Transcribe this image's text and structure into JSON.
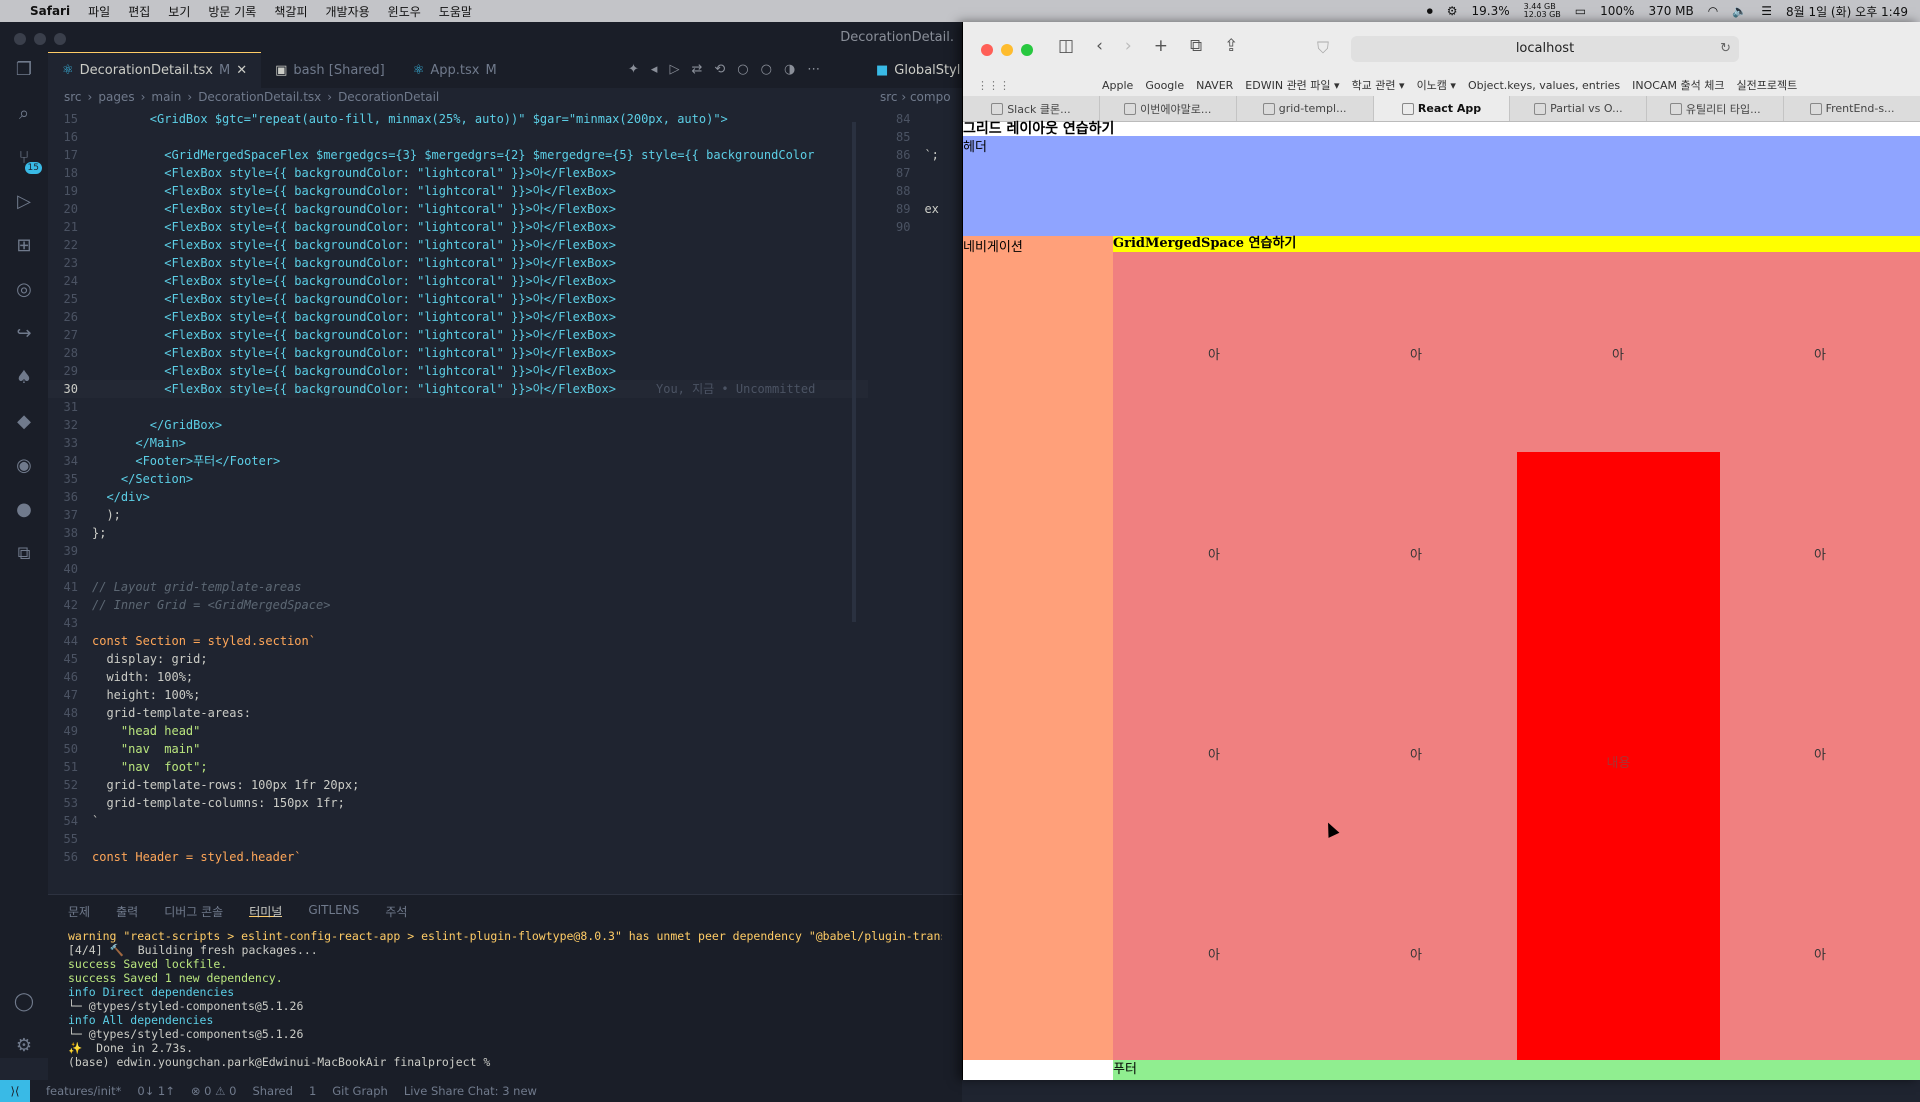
{
  "menubar": {
    "app": "Safari",
    "items": [
      "파일",
      "편집",
      "보기",
      "방문 기록",
      "책갈피",
      "개발자용",
      "윈도우",
      "도움말"
    ],
    "cpu": "19.3%",
    "mem_top": "3.44 GB",
    "mem_bottom": "12.03 GB",
    "battery": "100%",
    "ram": "370 MB",
    "datetime": "8월 1일 (화) 오후 1:49"
  },
  "vscode": {
    "window_title": "DecorationDetail.",
    "tabs": [
      {
        "label": "DecorationDetail.tsx",
        "mod": "M"
      },
      {
        "label": "bash [Shared]",
        "mod": ""
      },
      {
        "label": "App.tsx",
        "mod": "M"
      }
    ],
    "right_tab": "GlobalStyl",
    "breadcrumb": [
      "src",
      "pages",
      "main",
      "DecorationDetail.tsx",
      "DecorationDetail"
    ],
    "right_breadcrumb": "src › compo",
    "code_lines": [
      {
        "n": "15",
        "text": "        <GridBox $gtc=\"repeat(auto-fill, minmax(25%, auto))\" $gar=\"minmax(200px, auto)\">",
        "cls": "tag"
      },
      {
        "n": "16",
        "text": "",
        "cls": ""
      },
      {
        "n": "17",
        "text": "          <GridMergedSpaceFlex $mergedgcs={3} $mergedgrs={2} $mergedgre={5} style={{ backgroundColor",
        "cls": "tag"
      },
      {
        "n": "18",
        "text": "          <FlexBox style={{ backgroundColor: \"lightcoral\" }}>아</FlexBox>",
        "cls": "tag"
      },
      {
        "n": "19",
        "text": "          <FlexBox style={{ backgroundColor: \"lightcoral\" }}>아</FlexBox>",
        "cls": "tag"
      },
      {
        "n": "20",
        "text": "          <FlexBox style={{ backgroundColor: \"lightcoral\" }}>아</FlexBox>",
        "cls": "tag"
      },
      {
        "n": "21",
        "text": "          <FlexBox style={{ backgroundColor: \"lightcoral\" }}>아</FlexBox>",
        "cls": "tag"
      },
      {
        "n": "22",
        "text": "          <FlexBox style={{ backgroundColor: \"lightcoral\" }}>아</FlexBox>",
        "cls": "tag"
      },
      {
        "n": "23",
        "text": "          <FlexBox style={{ backgroundColor: \"lightcoral\" }}>아</FlexBox>",
        "cls": "tag"
      },
      {
        "n": "24",
        "text": "          <FlexBox style={{ backgroundColor: \"lightcoral\" }}>아</FlexBox>",
        "cls": "tag"
      },
      {
        "n": "25",
        "text": "          <FlexBox style={{ backgroundColor: \"lightcoral\" }}>아</FlexBox>",
        "cls": "tag"
      },
      {
        "n": "26",
        "text": "          <FlexBox style={{ backgroundColor: \"lightcoral\" }}>아</FlexBox>",
        "cls": "tag"
      },
      {
        "n": "27",
        "text": "          <FlexBox style={{ backgroundColor: \"lightcoral\" }}>아</FlexBox>",
        "cls": "tag"
      },
      {
        "n": "28",
        "text": "          <FlexBox style={{ backgroundColor: \"lightcoral\" }}>아</FlexBox>",
        "cls": "tag"
      },
      {
        "n": "29",
        "text": "          <FlexBox style={{ backgroundColor: \"lightcoral\" }}>아</FlexBox>",
        "cls": "tag"
      },
      {
        "n": "30",
        "text": "          <FlexBox style={{ backgroundColor: \"lightcoral\" }}>아</FlexBox>",
        "cls": "tag",
        "ghost": "You, 지금 • Uncommitted"
      },
      {
        "n": "31",
        "text": "",
        "cls": ""
      },
      {
        "n": "32",
        "text": "        </GridBox>",
        "cls": "tag"
      },
      {
        "n": "33",
        "text": "      </Main>",
        "cls": "tag"
      },
      {
        "n": "34",
        "text": "      <Footer>푸터</Footer>",
        "cls": "tag"
      },
      {
        "n": "35",
        "text": "    </Section>",
        "cls": "tag"
      },
      {
        "n": "36",
        "text": "  </div>",
        "cls": "tag"
      },
      {
        "n": "37",
        "text": "  );",
        "cls": ""
      },
      {
        "n": "38",
        "text": "};",
        "cls": ""
      },
      {
        "n": "39",
        "text": "",
        "cls": ""
      },
      {
        "n": "40",
        "text": "",
        "cls": ""
      },
      {
        "n": "41",
        "text": "// Layout grid-template-areas",
        "cls": "comment"
      },
      {
        "n": "42",
        "text": "// Inner Grid = <GridMergedSpace>",
        "cls": "comment"
      },
      {
        "n": "43",
        "text": "",
        "cls": ""
      },
      {
        "n": "44",
        "text": "const Section = styled.section`",
        "cls": "kw"
      },
      {
        "n": "45",
        "text": "  display: grid;",
        "cls": ""
      },
      {
        "n": "46",
        "text": "  width: 100%;",
        "cls": ""
      },
      {
        "n": "47",
        "text": "  height: 100%;",
        "cls": ""
      },
      {
        "n": "48",
        "text": "  grid-template-areas:",
        "cls": ""
      },
      {
        "n": "49",
        "text": "    \"head head\"",
        "cls": "str"
      },
      {
        "n": "50",
        "text": "    \"nav  main\"",
        "cls": "str"
      },
      {
        "n": "51",
        "text": "    \"nav  foot\";",
        "cls": "str"
      },
      {
        "n": "52",
        "text": "  grid-template-rows: 100px 1fr 20px;",
        "cls": ""
      },
      {
        "n": "53",
        "text": "  grid-template-columns: 150px 1fr;",
        "cls": ""
      },
      {
        "n": "54",
        "text": "`",
        "cls": ""
      },
      {
        "n": "55",
        "text": "",
        "cls": ""
      },
      {
        "n": "56",
        "text": "const Header = styled.header`",
        "cls": "kw"
      }
    ],
    "right_code": [
      {
        "n": "84",
        "text": ""
      },
      {
        "n": "85",
        "text": ""
      },
      {
        "n": "86",
        "text": "`;"
      },
      {
        "n": "87",
        "text": ""
      },
      {
        "n": "88",
        "text": ""
      },
      {
        "n": "89",
        "text": "ex"
      },
      {
        "n": "90",
        "text": ""
      }
    ],
    "panel_tabs": [
      "문제",
      "출력",
      "디버그 콘솔",
      "터미널",
      "GITLENS",
      "주석"
    ],
    "terminal": [
      {
        "cls": "t-warn",
        "text": "warning \"react-scripts > eslint-config-react-app > eslint-plugin-flowtype@8.0.3\" has unmet peer dependency \"@babel/plugin-trans"
      },
      {
        "cls": "",
        "text": "[4/4] 🔨  Building fresh packages..."
      },
      {
        "cls": "t-succ",
        "text": "success Saved lockfile."
      },
      {
        "cls": "t-succ",
        "text": "success Saved 1 new dependency."
      },
      {
        "cls": "t-info",
        "text": "info Direct dependencies"
      },
      {
        "cls": "",
        "text": "└─ @types/styled-components@5.1.26"
      },
      {
        "cls": "t-info",
        "text": "info All dependencies"
      },
      {
        "cls": "",
        "text": "└─ @types/styled-components@5.1.26"
      },
      {
        "cls": "",
        "text": "✨  Done in 2.73s."
      },
      {
        "cls": "",
        "text": "(base) edwin.youngchan.park@Edwinui-MacBookAir finalproject % "
      }
    ],
    "status": {
      "branch": "features/init*",
      "sync": "0↓ 1↑",
      "problems": "⊗ 0 ⚠ 0",
      "shared": "Shared",
      "count": "1",
      "git_graph": "Git Graph",
      "live_share": "Live Share Chat: 3 new"
    }
  },
  "safari": {
    "url": "localhost",
    "favorites": [
      "Apple",
      "Google",
      "NAVER",
      "EDWIN 관련 파일 ▾",
      "학교 관련 ▾",
      "이노캠 ▾",
      "Object.keys, values, entries",
      "INOCAM 출석 체크",
      "실전프로젝트"
    ],
    "tabs": [
      {
        "label": "Slack 클론...",
        "active": false
      },
      {
        "label": "이번에야말로...",
        "active": false
      },
      {
        "label": "grid-templ...",
        "active": false
      },
      {
        "label": "React App",
        "active": true
      },
      {
        "label": "Partial vs O...",
        "active": false
      },
      {
        "label": "유틸리티 타입...",
        "active": false
      },
      {
        "label": "FrentEnd-s...",
        "active": false
      }
    ],
    "page": {
      "h2": "그리드 레이아웃 연습하기",
      "header": "헤더",
      "nav": "네비게이션",
      "main_title": "GridMergedSpace 연습하기",
      "cell": "아",
      "merged_cell": "내용",
      "footer": "푸터"
    }
  }
}
